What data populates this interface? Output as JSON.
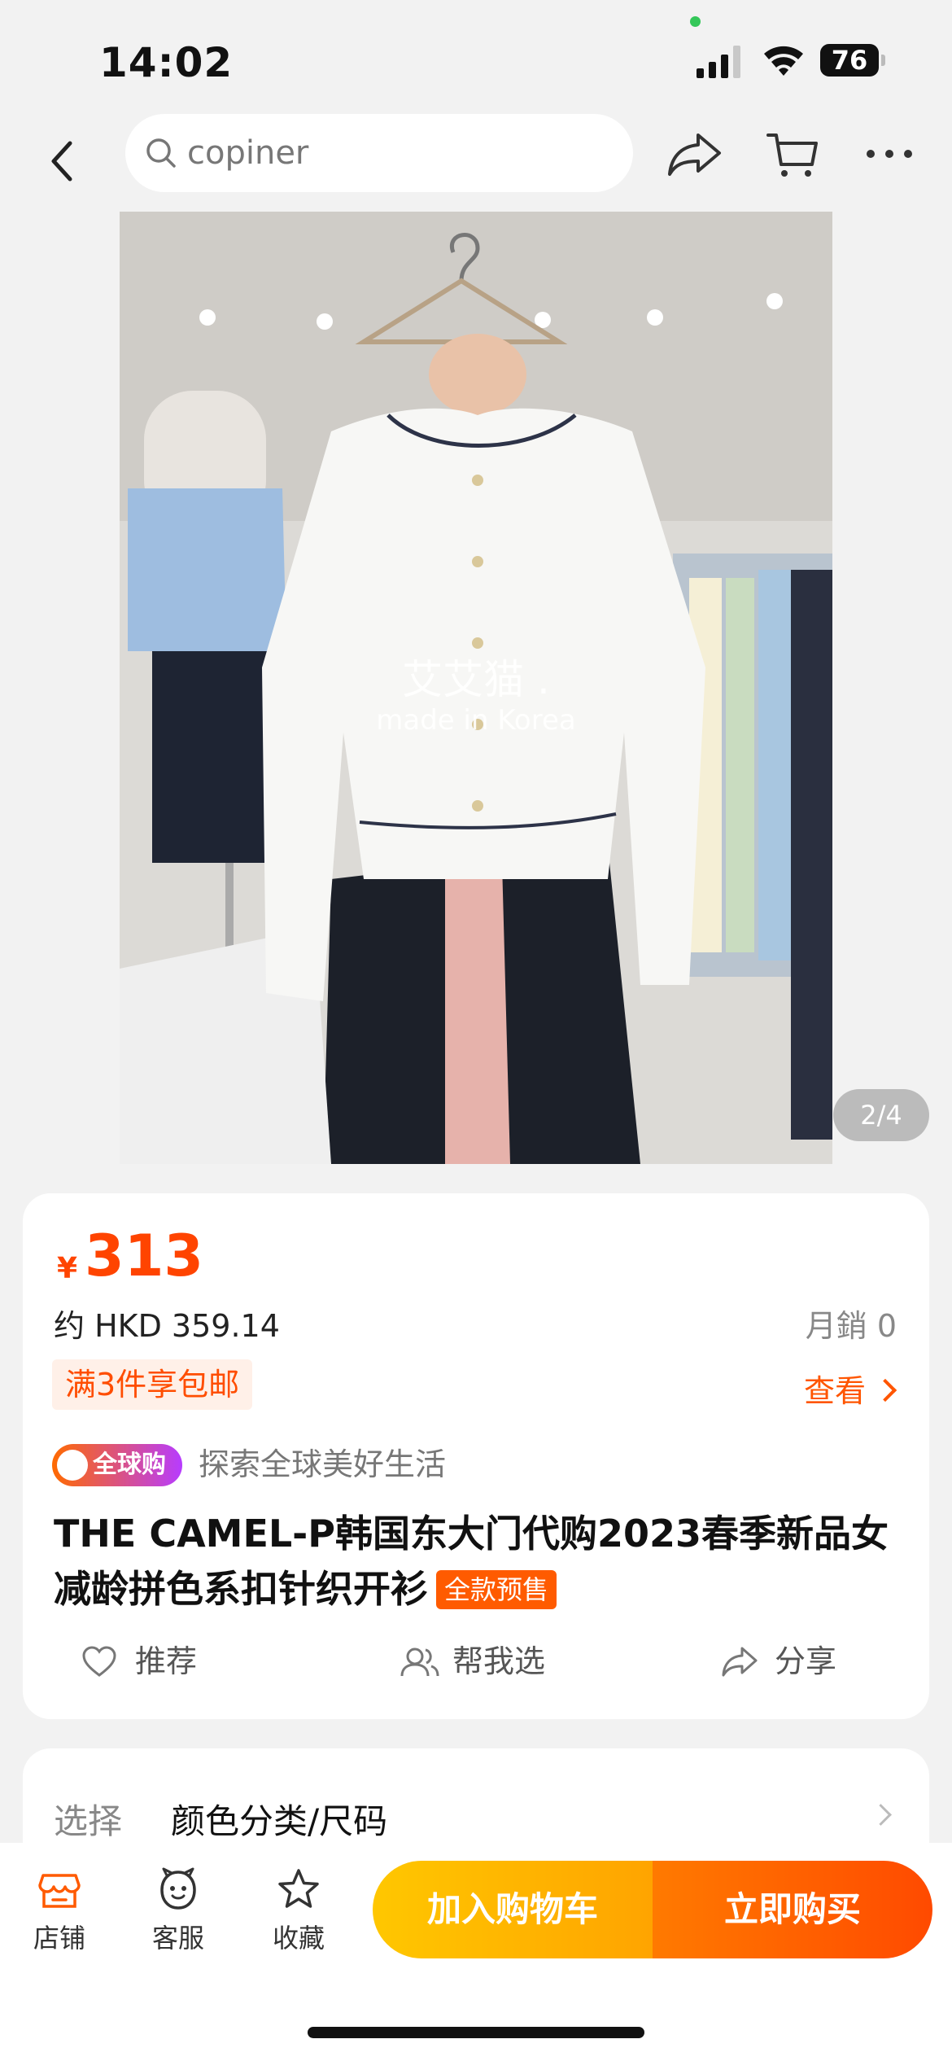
{
  "status_bar": {
    "time": "14:02",
    "battery": "76"
  },
  "nav": {
    "search_value": "copiner"
  },
  "gallery": {
    "watermark_cn": "艾艾猫 .",
    "watermark_en": "made in Korea",
    "pager": "2/4"
  },
  "product": {
    "currency": "¥",
    "price": "313",
    "hkd": "约 HKD 359.14",
    "monthly_sales": "月銷 0",
    "promo": "满3件享包邮",
    "view_link": "查看",
    "global_badge": "全球购",
    "slogan": "探索全球美好生活",
    "title": "THE CAMEL-P韩国东大门代购2023春季新品女减龄拼色系扣针织开衫",
    "presale_tag": "全款预售",
    "actions": {
      "recommend": "推荐",
      "help_choose": "帮我选",
      "share": "分享"
    }
  },
  "spec": {
    "label": "选择",
    "value": "颜色分类/尺码"
  },
  "bottom_bar": {
    "store": "店铺",
    "service": "客服",
    "favorite": "收藏",
    "add_to_cart": "加入购物车",
    "buy_now": "立即购买"
  },
  "colors": {
    "accent": "#ff4400",
    "cart_button": "#ffb400",
    "buy_button": "#ff5a00"
  }
}
